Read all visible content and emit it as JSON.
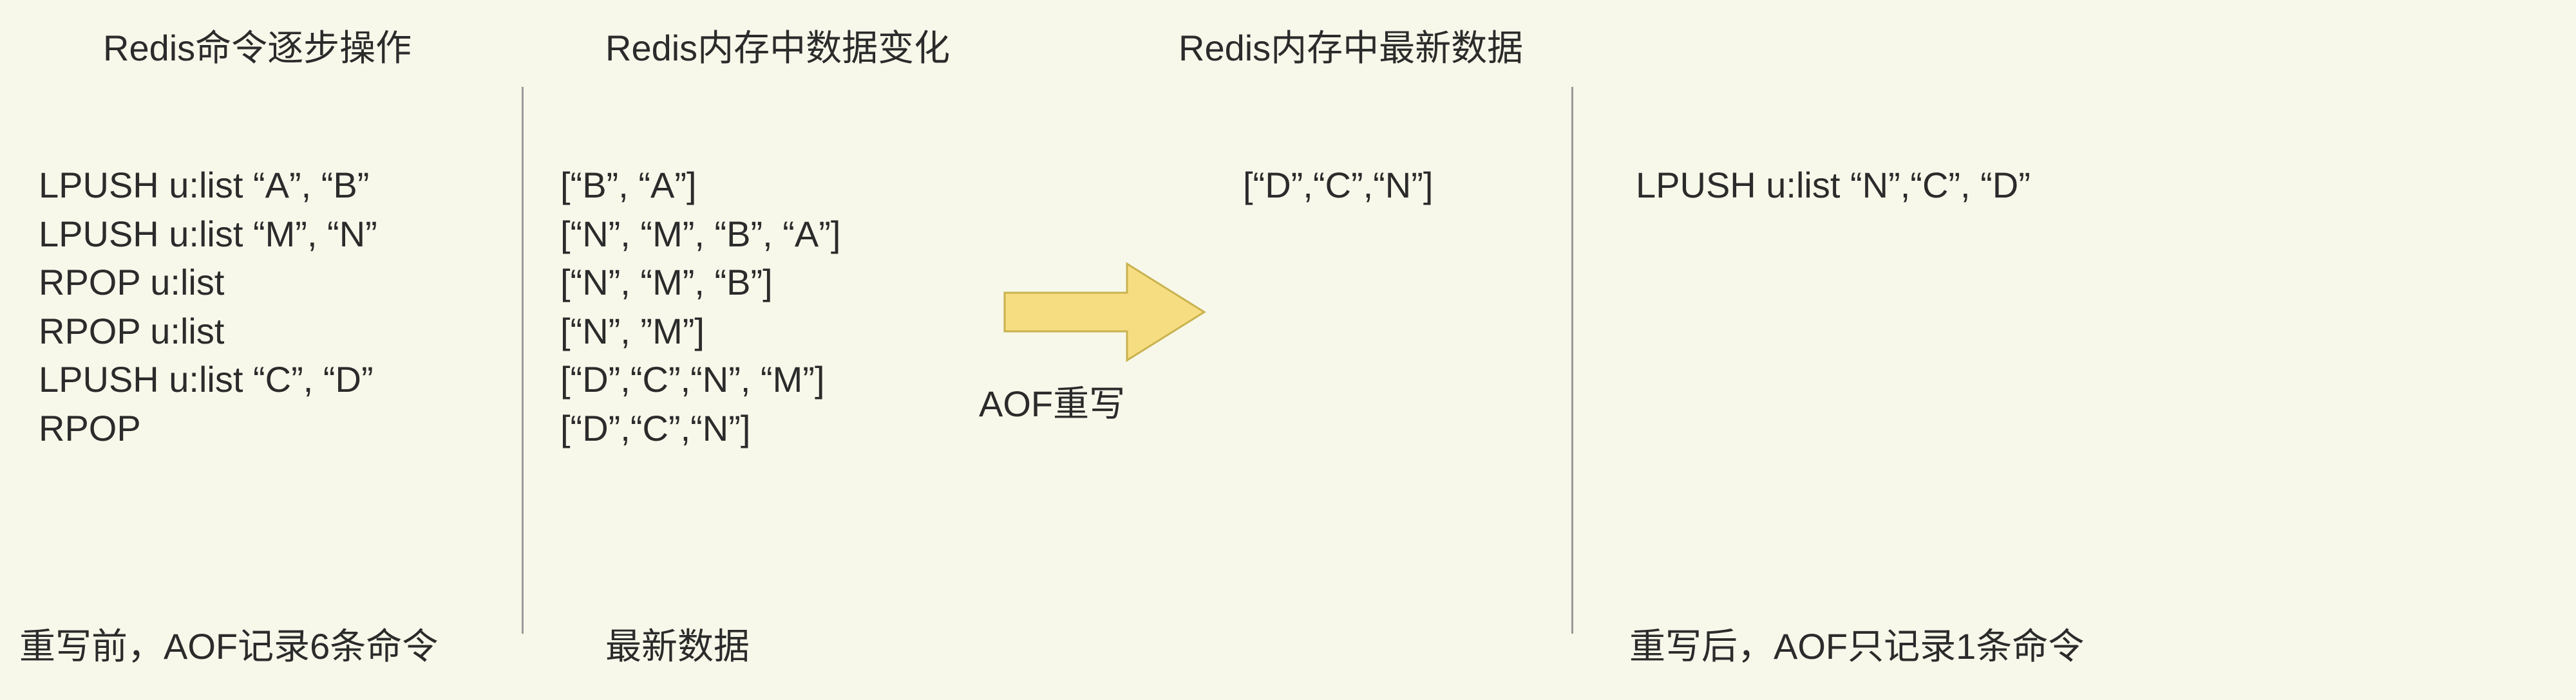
{
  "columns": {
    "commands": {
      "header": "Redis命令逐步操作",
      "lines": [
        "LPUSH  u:list  “A”, “B”",
        "LPUSH  u:list  “M”, “N”",
        "RPOP u:list",
        "RPOP u:list",
        "LPUSH u:list “C”, “D”",
        "RPOP"
      ],
      "footer": "重写前，AOF记录6条命令"
    },
    "changes": {
      "header": "Redis内存中数据变化",
      "lines": [
        "[“B”, “A”]",
        "[“N”, “M”, “B”, “A”]",
        "[“N”, “M”, “B”]",
        "[“N”, ”M”]",
        "[“D”,“C”,“N”, “M”]",
        "[“D”,“C”,“N”]"
      ],
      "footer": "最新数据"
    },
    "latest": {
      "header": "Redis内存中最新数据",
      "value": "[“D”,“C”,“N”]"
    },
    "rewritten": {
      "value": "LPUSH u:list “N”,“C”, “D”",
      "footer": "重写后，AOF只记录1条命令"
    }
  },
  "arrow_label": "AOF重写"
}
